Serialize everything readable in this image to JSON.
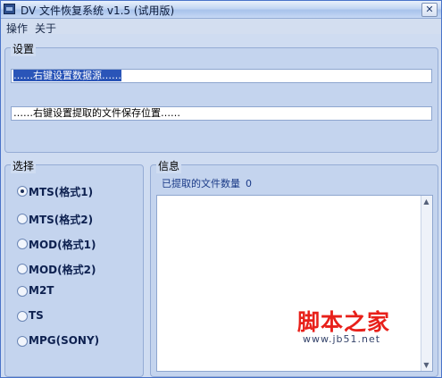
{
  "window": {
    "title": "DV 文件恢复系统 v1.5 (试用版)",
    "close_glyph": "✕"
  },
  "menu": {
    "items": [
      "操作",
      "关于"
    ]
  },
  "settings": {
    "title": "设置",
    "source_placeholder": "……右键设置数据源……",
    "save_path_placeholder": "……右键设置提取的文件保存位置……"
  },
  "select": {
    "title": "选择",
    "options": [
      {
        "label": "MTS(格式1)",
        "selected": true
      },
      {
        "label": "MTS(格式2)",
        "selected": false
      },
      {
        "label": "MOD(格式1)",
        "selected": false
      },
      {
        "label": "MOD(格式2)",
        "selected": false
      },
      {
        "label": "M2T",
        "selected": false
      },
      {
        "label": "TS",
        "selected": false
      },
      {
        "label": "MPG(SONY)",
        "selected": false
      }
    ]
  },
  "info": {
    "title": "信息",
    "extracted_label": "已提取的文件数量",
    "extracted_count": "0",
    "scroll_up_glyph": "▲",
    "scroll_down_glyph": "▼"
  },
  "watermark": {
    "logo_text": "脚本之家",
    "url": "www.jb51.net"
  },
  "colors": {
    "window_bg": "#cfdcf1",
    "group_bg": "#c4d4ee",
    "selection": "#2a55b8",
    "info_text": "#1a3a87",
    "watermark_red": "#e8201a"
  }
}
